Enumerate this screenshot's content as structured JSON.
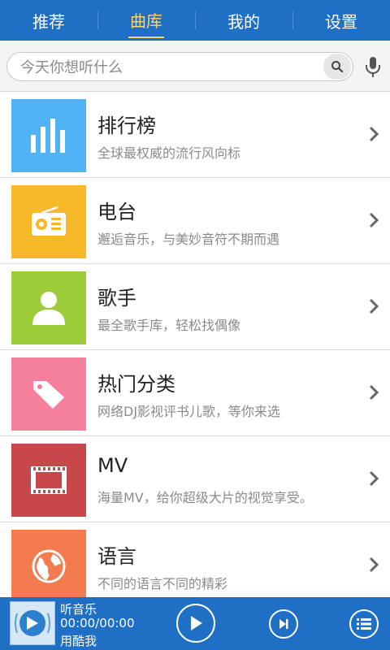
{
  "tabs": [
    {
      "label": "推荐"
    },
    {
      "label": "曲库"
    },
    {
      "label": "我的"
    },
    {
      "label": "设置"
    }
  ],
  "search": {
    "placeholder": "今天你想听什么"
  },
  "items": [
    {
      "title": "排行榜",
      "subtitle": "全球最权威的流行风向标",
      "color": "#4fb3f5",
      "icon": "chart-bars-icon"
    },
    {
      "title": "电台",
      "subtitle": "邂逅音乐，与美妙音符不期而遇",
      "color": "#f7b82a",
      "icon": "radio-icon"
    },
    {
      "title": "歌手",
      "subtitle": "最全歌手库，轻松找偶像",
      "color": "#9ccc3a",
      "icon": "person-icon"
    },
    {
      "title": "热门分类",
      "subtitle": "网络DJ影视评书儿歌，等你来选",
      "color": "#f4809e",
      "icon": "tag-icon"
    },
    {
      "title": "MV",
      "subtitle": "海量MV，给你超级大片的视觉享受。",
      "color": "#c8474a",
      "icon": "film-icon"
    },
    {
      "title": "语言",
      "subtitle": "不同的语言不同的精彩",
      "color": "#f47b4f",
      "icon": "globe-icon"
    }
  ],
  "player": {
    "title": "听音乐",
    "time": "00:00/00:00",
    "subtitle": "用酷我"
  },
  "colors": {
    "header": "#1f6fc4",
    "active_tab": "#f7d66b"
  }
}
